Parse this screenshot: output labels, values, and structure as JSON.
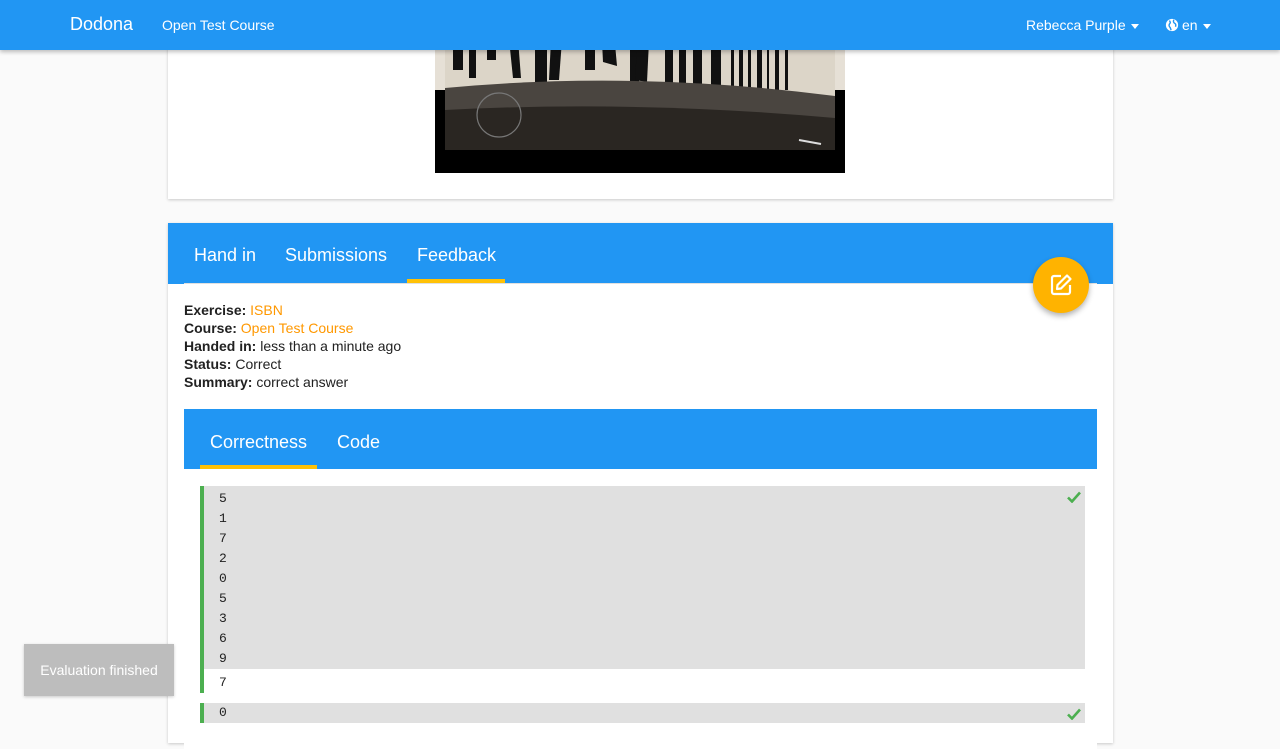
{
  "navbar": {
    "brand": "Dodona",
    "course": "Open Test Course",
    "user": "Rebecca Purple",
    "language": "en"
  },
  "main_tabs": [
    {
      "label": "Hand in"
    },
    {
      "label": "Submissions"
    },
    {
      "label": "Feedback"
    }
  ],
  "active_main_tab": "Feedback",
  "submission": {
    "exercise_label": "Exercise:",
    "exercise": "ISBN",
    "course_label": "Course:",
    "course": "Open Test Course",
    "handed_in_label": "Handed in:",
    "handed_in": "less than a minute ago",
    "status_label": "Status:",
    "status": "Correct",
    "summary_label": "Summary:",
    "summary": "correct answer"
  },
  "feedback_tabs": [
    {
      "label": "Correctness"
    },
    {
      "label": "Code"
    }
  ],
  "active_feedback_tab": "Correctness",
  "testcases": [
    {
      "lines": [
        "5",
        "1",
        "7",
        "2",
        "0",
        "5",
        "3",
        "6",
        "9"
      ],
      "result": "7",
      "status": "correct"
    },
    {
      "lines": [
        "0"
      ],
      "status": "correct"
    }
  ],
  "toast": "Evaluation finished",
  "colors": {
    "primary": "#2196f3",
    "accent": "#ffc107",
    "link": "#ff9800",
    "success": "#4caf50",
    "fab": "#ffb300"
  },
  "icons": {
    "fab": "edit-icon",
    "language": "globe-icon",
    "testcase_status": "check-icon"
  }
}
